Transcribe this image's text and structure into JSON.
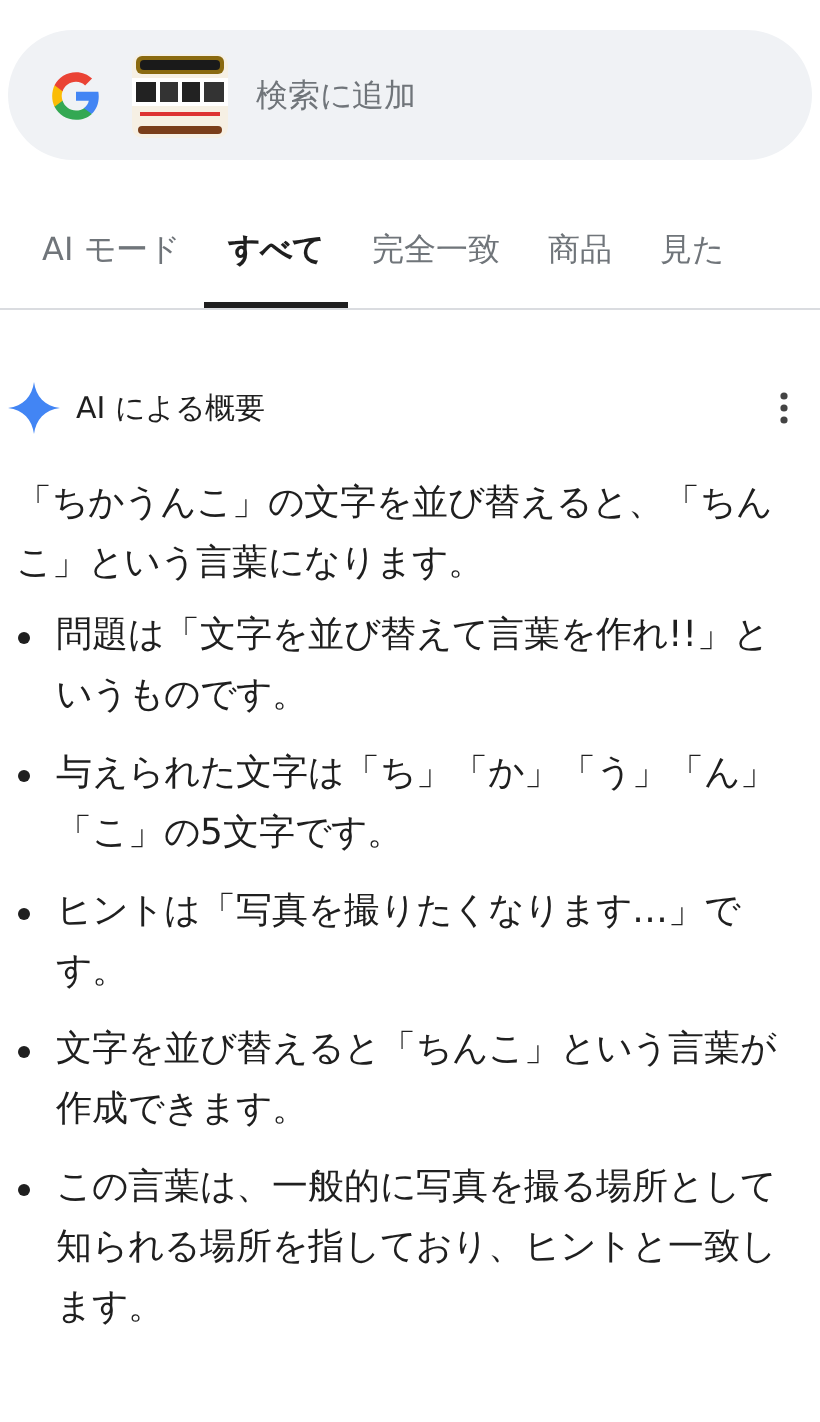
{
  "search": {
    "placeholder": "検索に追加"
  },
  "tabs": [
    {
      "label": "AI モード",
      "selected": false
    },
    {
      "label": "すべて",
      "selected": true
    },
    {
      "label": "完全一致",
      "selected": false
    },
    {
      "label": "商品",
      "selected": false
    },
    {
      "label": "見た",
      "selected": false
    }
  ],
  "overview": {
    "title": "AI による概要",
    "intro": "「ちかうんこ」の文字を並び替えると、「ちんこ」という言葉になります。",
    "bullets": [
      "問題は「文字を並び替えて言葉を作れ!!」というものです。",
      "与えられた文字は「ち」「か」「う」「ん」「こ」の5文字です。",
      "ヒントは「写真を撮りたくなります…」です。",
      "文字を並び替えると「ちんこ」という言葉が作成できます。",
      "この言葉は、一般的に写真を撮る場所として知られる場所を指しており、ヒントと一致します。"
    ]
  }
}
